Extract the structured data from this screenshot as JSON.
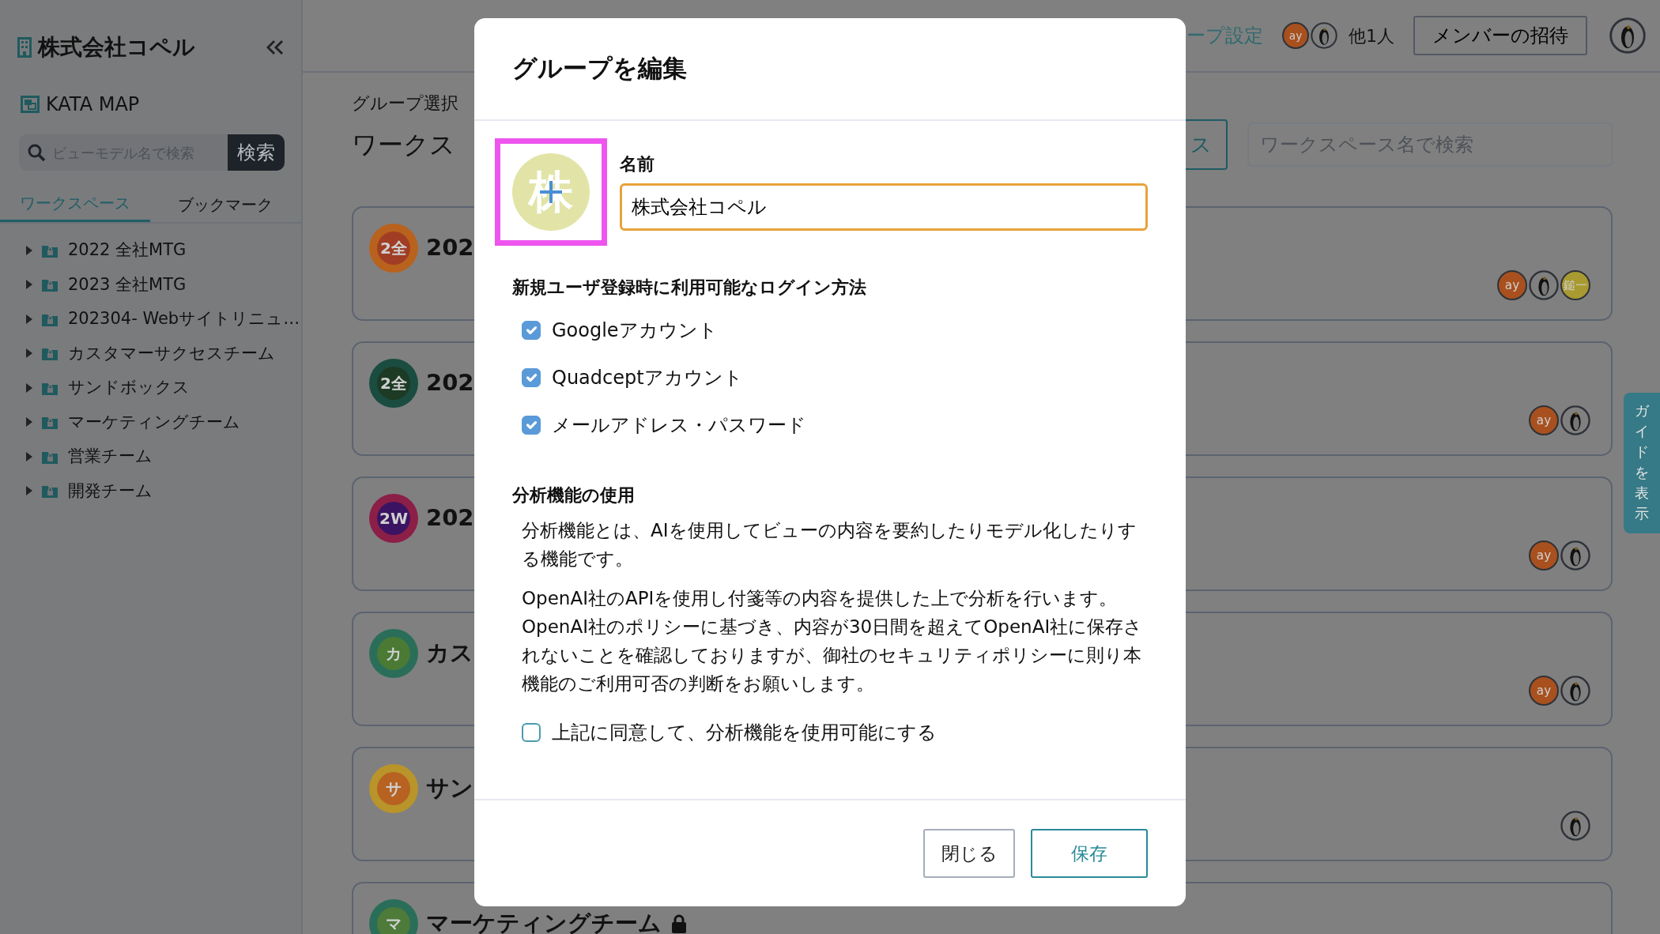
{
  "sidebar": {
    "company": "株式会社コペル",
    "app": "KATA MAP",
    "search": {
      "placeholder": "ビューモデル名で検索",
      "button": "検索"
    },
    "tabs": [
      {
        "label": "ワークスペース",
        "selected": true
      },
      {
        "label": "ブックマーク",
        "selected": false
      }
    ],
    "tree": [
      {
        "label": "2022 全社MTG",
        "expanded": false
      },
      {
        "label": "2023 全社MTG",
        "expanded": false
      },
      {
        "label": "202304- Webサイトリニュ…",
        "expanded": false
      },
      {
        "label": "カスタマーサクセスチーム",
        "expanded": false
      },
      {
        "label": "サンドボックス",
        "expanded": false
      },
      {
        "label": "マーケティングチーム",
        "expanded": false
      },
      {
        "label": "営業チーム",
        "expanded": false
      },
      {
        "label": "開発チーム",
        "expanded": false
      }
    ]
  },
  "topbar": {
    "link": "ープ設定",
    "members": [
      {
        "kind": "initials",
        "text": "ay",
        "color": "#a8501e"
      },
      {
        "kind": "photo"
      }
    ],
    "others": "他1人",
    "invite_button": "メンバーの招待",
    "user": {
      "kind": "photo"
    }
  },
  "main": {
    "hint": "グループ選択",
    "title": "ワークス",
    "create_button": "ス",
    "search": {
      "placeholder": "ワークスペース名で検索"
    },
    "workspaces": [
      {
        "icon_ring": {
          "color": "#b8621e"
        },
        "icon_badge": {
          "text": "2全",
          "color": "#a03d24"
        },
        "title": "202",
        "locked": false,
        "members": [
          {
            "kind": "initials",
            "text": "ay",
            "color": "#a8501e"
          },
          {
            "kind": "photo"
          },
          {
            "kind": "initials",
            "text": "鎚一",
            "color": "#a89a30"
          }
        ]
      },
      {
        "icon_ring": {
          "color": "#1a4c40"
        },
        "icon_badge": {
          "text": "2全",
          "color": "#1c3a24"
        },
        "title": "202",
        "locked": false,
        "members": [
          {
            "kind": "initials",
            "text": "ay",
            "color": "#a8501e"
          },
          {
            "kind": "photo"
          }
        ]
      },
      {
        "icon_ring": {
          "color": "#8c1f47"
        },
        "icon_badge": {
          "text": "2W",
          "color": "#3a1462"
        },
        "title": "202",
        "locked": false,
        "members": [
          {
            "kind": "initials",
            "text": "ay",
            "color": "#a8501e"
          },
          {
            "kind": "photo"
          }
        ]
      },
      {
        "icon_ring": {
          "color": "#2a6e5a"
        },
        "icon_badge": {
          "text": "カ",
          "color": "#4a7a34"
        },
        "title": "カス",
        "locked": false,
        "members": [
          {
            "kind": "initials",
            "text": "ay",
            "color": "#a8501e"
          },
          {
            "kind": "photo"
          }
        ]
      },
      {
        "icon_ring": {
          "color": "#b8942a"
        },
        "icon_badge": {
          "text": "サ",
          "color": "#b86222"
        },
        "title": "サン",
        "locked": false,
        "members": [
          {
            "kind": "photo"
          }
        ]
      },
      {
        "icon_ring": {
          "color": "#2a6e5a"
        },
        "icon_badge": {
          "text": "マ",
          "color": "#4e7a3a"
        },
        "title": "マーケティングチーム",
        "locked": true
      }
    ]
  },
  "guide_tab": "ガイドを表示",
  "modal": {
    "title": "グループを編集",
    "icon": {
      "text": "株",
      "highlighted": true
    },
    "name": {
      "label": "名前",
      "value": "株式会社コペル",
      "focused": true
    },
    "login": {
      "heading": "新規ユーザ登録時に利用可能なログイン方法",
      "options": [
        {
          "label": "Googleアカウント",
          "checked": true
        },
        {
          "label": "Quadceptアカウント",
          "checked": true
        },
        {
          "label": "メールアドレス・パスワード",
          "checked": true
        }
      ]
    },
    "analysis": {
      "heading": "分析機能の使用",
      "paragraphs": [
        "分析機能とは、AIを使用してビューの内容を要約したりモデル化したりする機能です。",
        "OpenAI社のAPIを使用し付箋等の内容を提供した上で分析を行います。OpenAI社のポリシーに基づき、内容が30日間を超えてOpenAI社に保存されないことを確認しておりますが、御社のセキュリティポリシーに則り本機能のご利用可否の判断をお願いします。"
      ],
      "consent": {
        "label": "上記に同意して、分析機能を使用可能にする",
        "checked": false
      }
    },
    "buttons": [
      {
        "label": "閉じる",
        "kind": "secondary"
      },
      {
        "label": "保存",
        "kind": "primary"
      }
    ]
  }
}
